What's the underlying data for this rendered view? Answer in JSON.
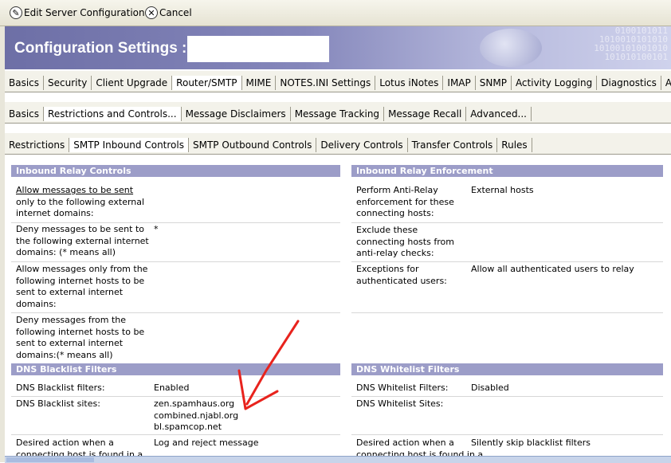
{
  "toolbar": {
    "edit_label": "Edit Server Configuration",
    "cancel_label": "Cancel"
  },
  "banner": {
    "title": "Configuration Settings :",
    "binary_text": "0100101011\n1010010101010\n10100101001010\n101010100101"
  },
  "tabs_main": [
    "Basics",
    "Security",
    "Client Upgrade",
    "Router/SMTP",
    "MIME",
    "NOTES.INI Settings",
    "Lotus iNotes",
    "IMAP",
    "SNMP",
    "Activity Logging",
    "Diagnostics",
    "Admin"
  ],
  "tabs_sub": [
    "Basics",
    "Restrictions and Controls...",
    "Message Disclaimers",
    "Message Tracking",
    "Message Recall",
    "Advanced..."
  ],
  "tabs_sub2": [
    "Restrictions",
    "SMTP Inbound Controls",
    "SMTP Outbound Controls",
    "Delivery Controls",
    "Transfer Controls",
    "Rules"
  ],
  "left": {
    "relay_header": "Inbound Relay Controls",
    "allow_sent_l1": "Allow messages to be sent",
    "allow_sent_l2": "only to the following external",
    "allow_sent_l3": "internet domains:",
    "deny_sent_l1": "Deny messages to be sent to",
    "deny_sent_l2": "the following external internet",
    "deny_sent_l3": "domains: (* means all)",
    "deny_sent_value": "*",
    "allow_hosts_l1": "Allow messages only from the",
    "allow_hosts_l2": "following internet hosts to be",
    "allow_hosts_l3": "sent to external internet",
    "allow_hosts_l4": "domains:",
    "deny_hosts_l1": "Deny messages from the",
    "deny_hosts_l2": "following internet hosts to be",
    "deny_hosts_l3": "sent to external internet",
    "deny_hosts_l4": "domains:(* means all)",
    "dnsbl_header": "DNS Blacklist Filters",
    "dnsbl_filters_label": "DNS Blacklist filters:",
    "dnsbl_filters_value": "Enabled",
    "dnsbl_sites_label": "DNS Blacklist sites:",
    "dnsbl_site1": "zen.spamhaus.org",
    "dnsbl_site2": "combined.njabl.org",
    "dnsbl_site3": "bl.spamcop.net",
    "action_l1": "Desired action when a",
    "action_l2": "connecting host is found in a",
    "action_value": "Log and reject message"
  },
  "right": {
    "enforce_header": "Inbound Relay Enforcement",
    "antirelay_l1": "Perform Anti-Relay",
    "antirelay_l2": "enforcement for these",
    "antirelay_l3": "connecting hosts:",
    "antirelay_value": "External hosts",
    "exclude_l1": "Exclude these",
    "exclude_l2": "connecting hosts from",
    "exclude_l3": "anti-relay checks:",
    "exceptions_l1": "Exceptions for",
    "exceptions_l2": "authenticated users:",
    "exceptions_value": "Allow all authenticated users to relay",
    "dnswl_header": "DNS Whitelist Filters",
    "dnswl_filters_label": "DNS Whitelist Filters:",
    "dnswl_filters_value": "Disabled",
    "dnswl_sites_label": "DNS Whitelist Sites:",
    "action_l1": "Desired action when a",
    "action_l2": "connecting host is found in a",
    "action_value": "Silently skip blacklist filters"
  },
  "colors": {
    "section_header": "#9c9dc8",
    "annotation_arrow": "#e8231d"
  }
}
